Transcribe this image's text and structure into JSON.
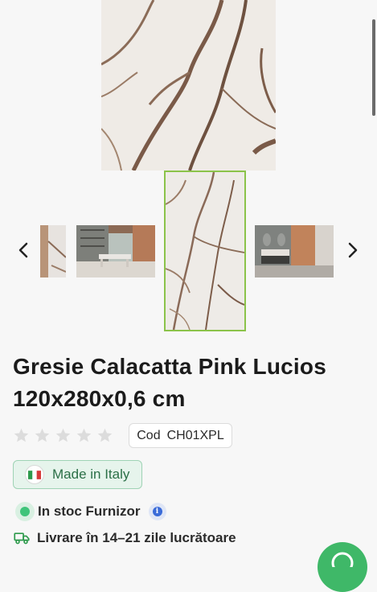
{
  "product": {
    "title": "Gresie Calacatta Pink Lucios 120x280x0,6 cm",
    "cod_label": "Cod",
    "cod_value": "CH01XPL",
    "rating": 0,
    "rating_max": 5
  },
  "badges": {
    "made_in": "Made in Italy"
  },
  "stock": {
    "label": "In stoc Furnizor"
  },
  "delivery": {
    "label": "Livrare în 14–21 zile lucrătoare"
  },
  "gallery": {
    "selected_index": 2,
    "thumbnails": [
      "marble-crop",
      "dining-room",
      "marble-slab",
      "bathroom"
    ]
  },
  "icons": [
    "chevron-left-icon",
    "chevron-right-icon",
    "star-icon",
    "italy-flag-icon",
    "info-icon",
    "truck-icon",
    "chat-icon"
  ],
  "colors": {
    "selected_border": "#8bc34a",
    "badge_green": "#2b6f47",
    "stock_green": "#3fc47a",
    "fab_green": "#3fb868"
  }
}
